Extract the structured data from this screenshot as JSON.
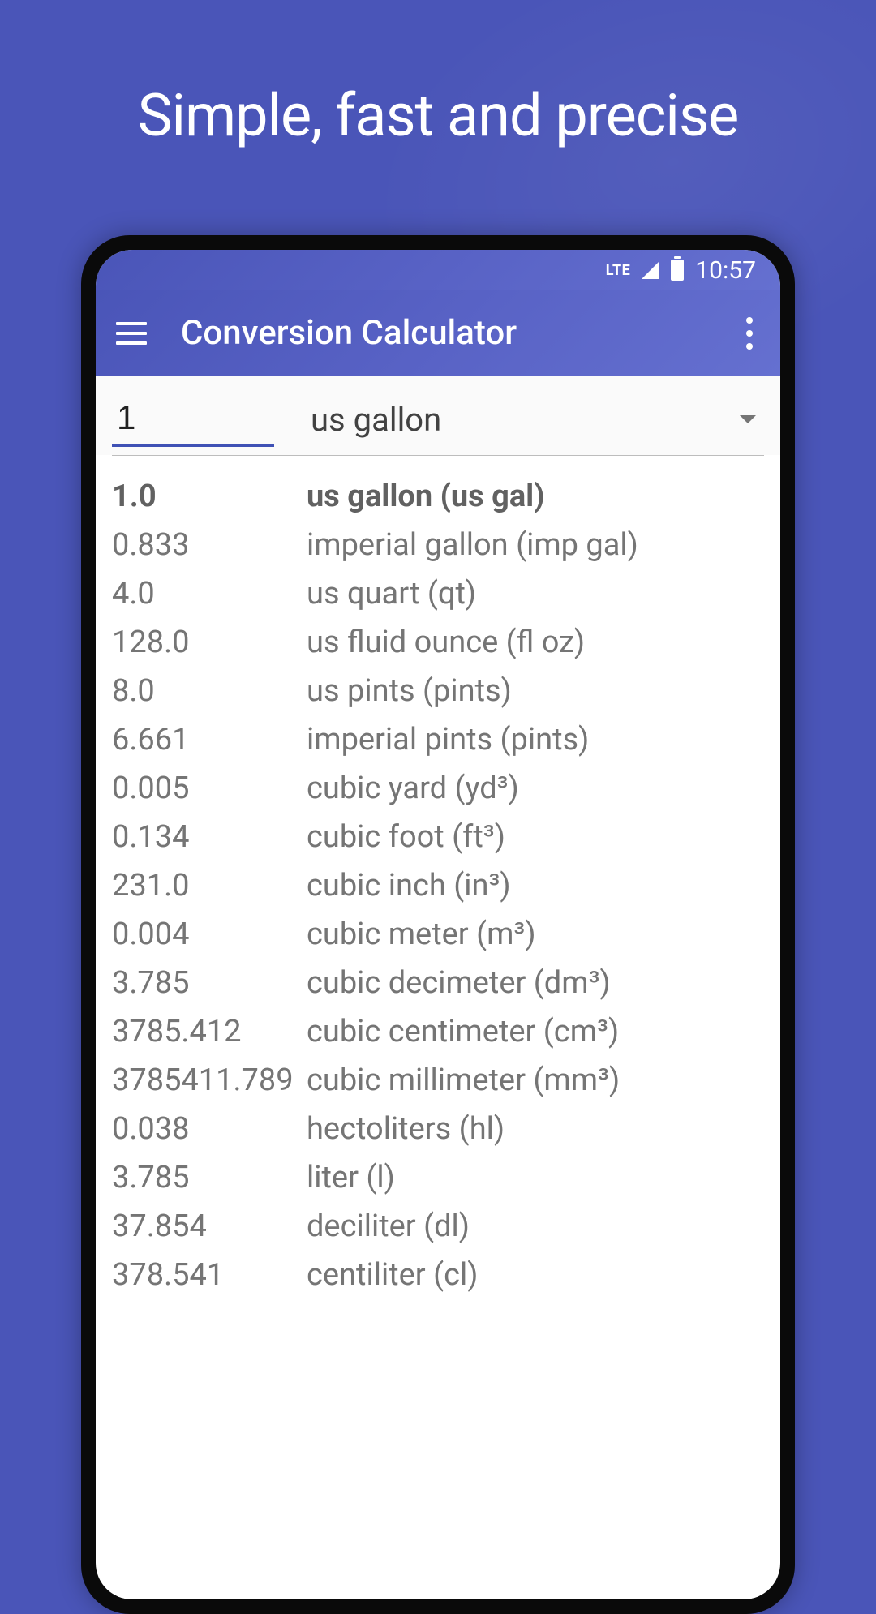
{
  "headline": "Simple, fast and precise",
  "statusBar": {
    "lte": "LTE",
    "time": "10:57"
  },
  "appBar": {
    "title": "Conversion Calculator"
  },
  "input": {
    "value": "1",
    "unit": "us gallon"
  },
  "results": [
    {
      "value": "1.0",
      "label": "us gallon (us gal)",
      "highlighted": true
    },
    {
      "value": "0.833",
      "label": "imperial gallon (imp gal)",
      "highlighted": false
    },
    {
      "value": "4.0",
      "label": "us quart (qt)",
      "highlighted": false
    },
    {
      "value": "128.0",
      "label": "us fluid ounce (fl oz)",
      "highlighted": false
    },
    {
      "value": "8.0",
      "label": "us pints (pints)",
      "highlighted": false
    },
    {
      "value": "6.661",
      "label": "imperial pints (pints)",
      "highlighted": false
    },
    {
      "value": "0.005",
      "label": "cubic yard (yd³)",
      "highlighted": false
    },
    {
      "value": "0.134",
      "label": "cubic foot (ft³)",
      "highlighted": false
    },
    {
      "value": "231.0",
      "label": "cubic inch (in³)",
      "highlighted": false
    },
    {
      "value": "0.004",
      "label": "cubic meter (m³)",
      "highlighted": false
    },
    {
      "value": "3.785",
      "label": "cubic decimeter (dm³)",
      "highlighted": false
    },
    {
      "value": "3785.412",
      "label": "cubic centimeter (cm³)",
      "highlighted": false
    },
    {
      "value": "3785411.789",
      "label": "cubic millimeter (mm³)",
      "highlighted": false
    },
    {
      "value": "0.038",
      "label": "hectoliters (hl)",
      "highlighted": false
    },
    {
      "value": "3.785",
      "label": "liter (l)",
      "highlighted": false
    },
    {
      "value": "37.854",
      "label": "deciliter (dl)",
      "highlighted": false
    },
    {
      "value": "378.541",
      "label": "centiliter (cl)",
      "highlighted": false
    }
  ]
}
